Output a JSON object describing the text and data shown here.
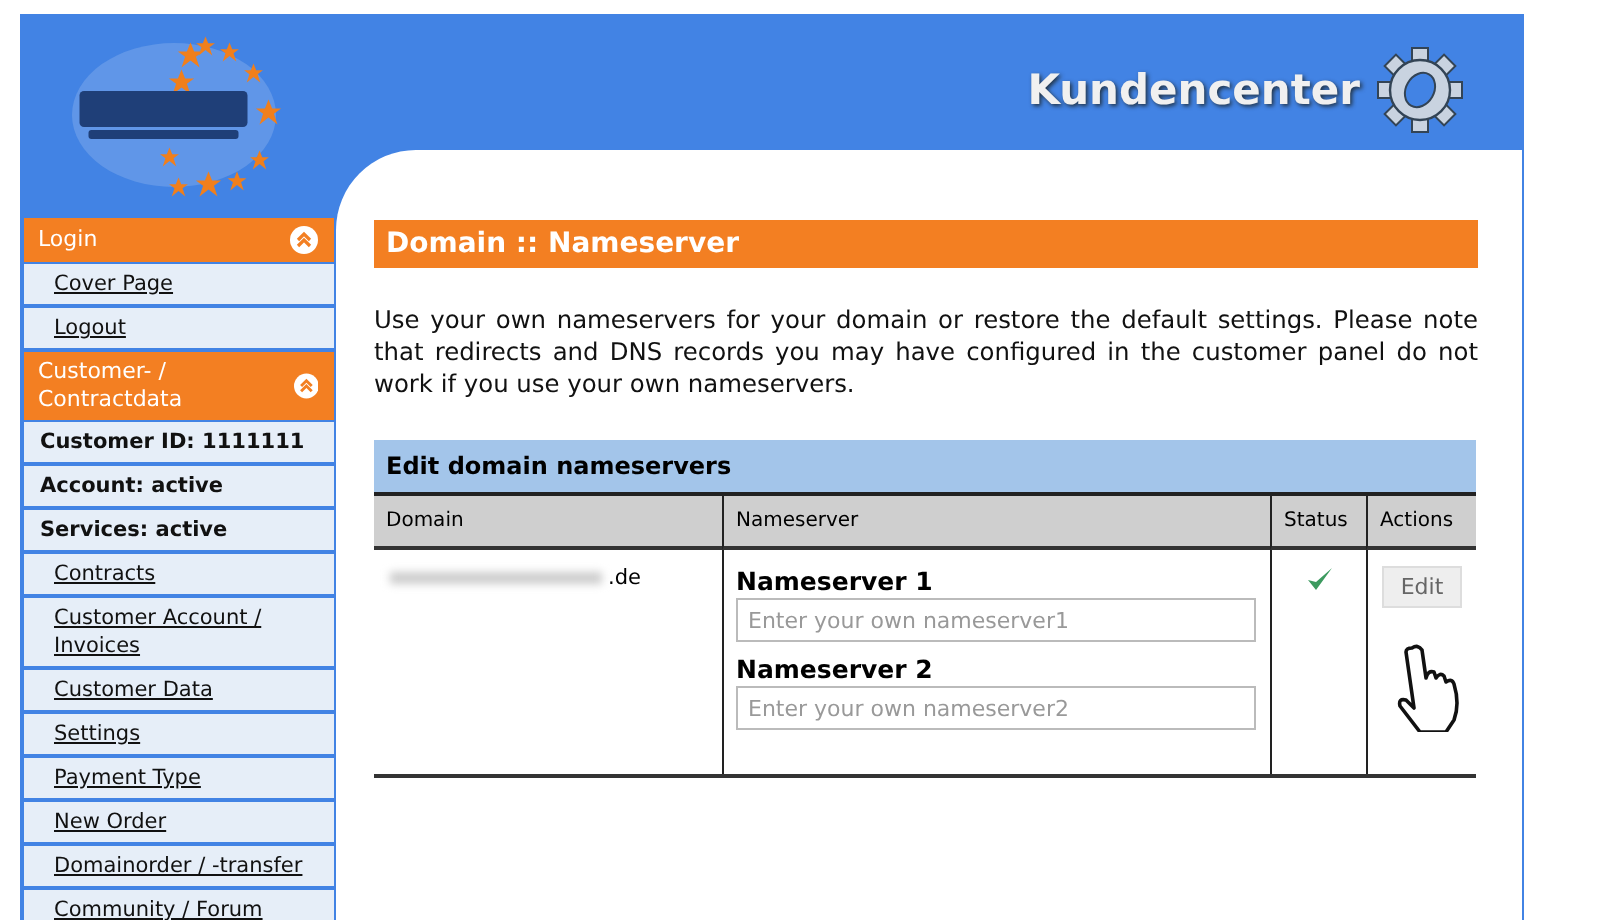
{
  "header": {
    "title": "Kundencenter"
  },
  "sidebar": {
    "items": [
      {
        "kind": "header",
        "label": "Login",
        "expanded": true
      },
      {
        "kind": "link",
        "label": "Cover Page"
      },
      {
        "kind": "link",
        "label": "Logout"
      },
      {
        "kind": "header",
        "label": "Customer- / Contractdata",
        "expanded": true
      },
      {
        "kind": "info",
        "label": "Customer ID: 1111111"
      },
      {
        "kind": "info",
        "label": "Account: active"
      },
      {
        "kind": "info",
        "label": "Services: active"
      },
      {
        "kind": "link",
        "label": "Contracts"
      },
      {
        "kind": "link",
        "label": "Customer Account / Invoices"
      },
      {
        "kind": "link",
        "label": "Customer Data"
      },
      {
        "kind": "link",
        "label": "Settings"
      },
      {
        "kind": "link",
        "label": "Payment Type"
      },
      {
        "kind": "link",
        "label": "New Order"
      },
      {
        "kind": "link",
        "label": "Domainorder / -transfer"
      },
      {
        "kind": "link",
        "label": "Community / Forum"
      }
    ]
  },
  "content": {
    "title": "Domain :: Nameserver",
    "intro": "Use your own nameservers for your domain or restore the default settings. Please note that redirects and DNS records you may have configured in the customer panel do not work if you use your own nameservers.",
    "table": {
      "title": "Edit domain nameservers",
      "columns": [
        "Domain",
        "Nameserver",
        "Status",
        "Actions"
      ],
      "rows": [
        {
          "domain_suffix": ".de",
          "nameservers": [
            {
              "label": "Nameserver 1",
              "placeholder": "Enter your own nameserver1"
            },
            {
              "label": "Nameserver 2",
              "placeholder": "Enter your own nameserver2"
            }
          ],
          "status_ok": true,
          "action": "Edit"
        }
      ]
    }
  }
}
